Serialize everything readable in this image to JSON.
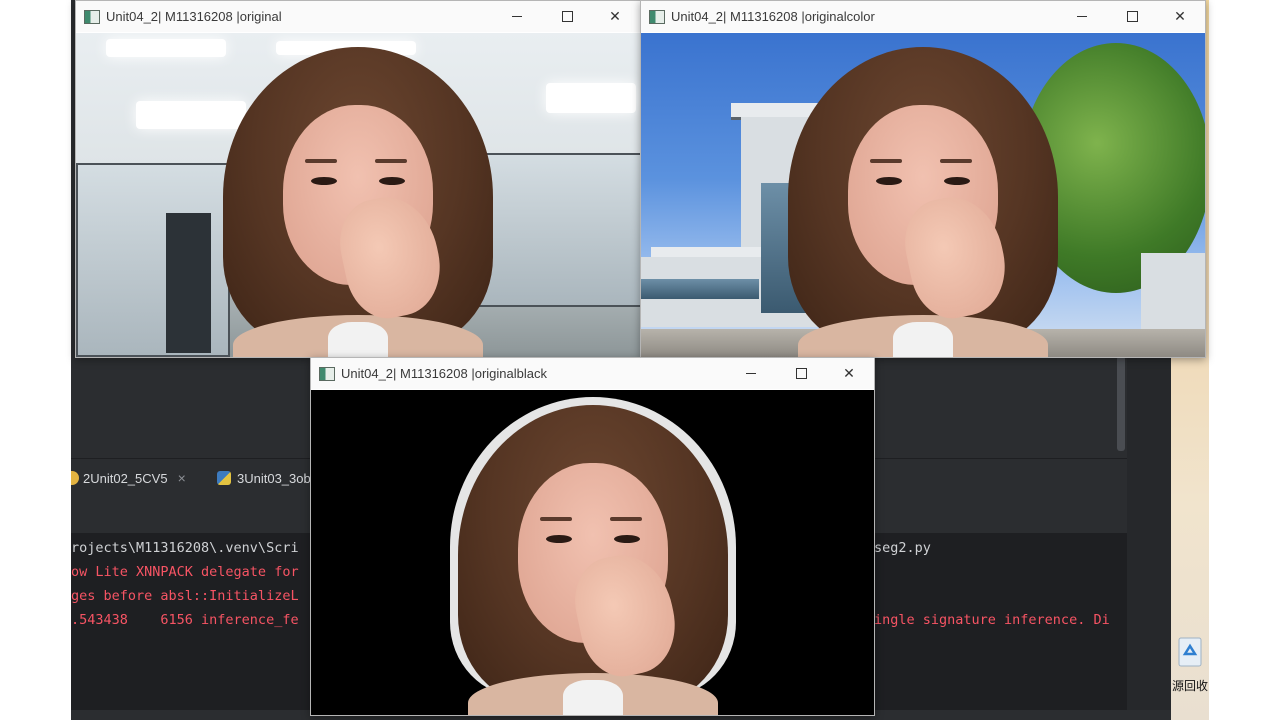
{
  "windows": [
    {
      "title": "Unit04_2| M11316208 |original",
      "scene": "office"
    },
    {
      "title": "Unit04_2| M11316208 |originalcolor",
      "scene": "building"
    },
    {
      "title": "Unit04_2| M11316208 |originalblack",
      "scene": "black"
    }
  ],
  "ide": {
    "tabs": [
      {
        "label": "2Unit02_5CV5",
        "close": "×"
      },
      {
        "label": "3Unit03_3ob"
      }
    ],
    "console": {
      "lines_left": [
        "rojects\\M11316208\\.venv\\Scri",
        "ow Lite XNNPACK delegate for",
        "ges before absl::InitializeL",
        ".543438    6156 inference_fe"
      ],
      "lines_right": [
        "seg2.py",
        "",
        "",
        "ingle signature inference. Di"
      ]
    }
  },
  "desktop": {
    "recycle_bin_label": "源回收"
  },
  "colors": {
    "console_error": "#f75464",
    "console_text": "#cfd1d4",
    "ide_background": "#2b2d30"
  }
}
